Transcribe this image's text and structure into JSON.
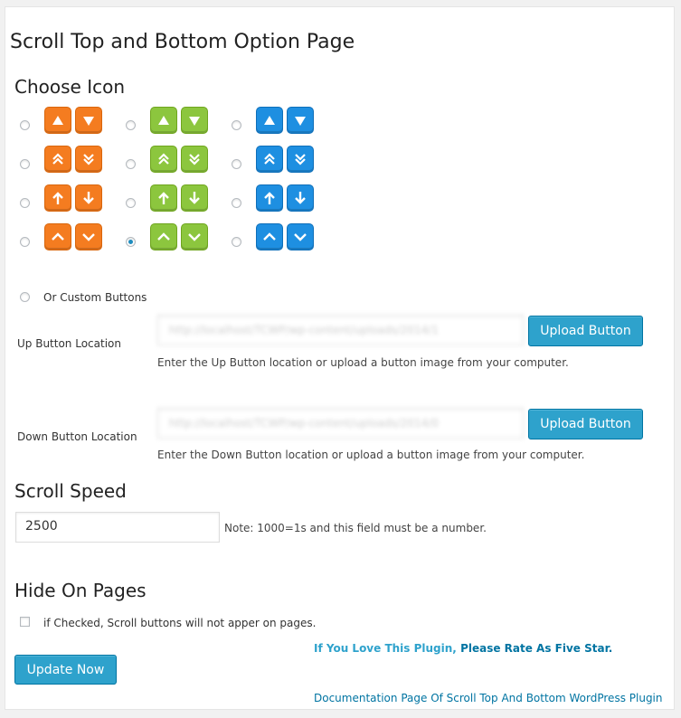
{
  "page_title": "Scroll Top and Bottom Option Page",
  "choose_icon": {
    "heading": "Choose Icon",
    "selected": "green-chevron",
    "colors": {
      "orange": "#f47c20",
      "green": "#8cc63e",
      "blue": "#1e8fe1"
    },
    "styles": [
      "triangle",
      "double-chevron",
      "arrow",
      "chevron"
    ]
  },
  "custom_buttons": {
    "label": "Or Custom Buttons",
    "up": {
      "label": "Up Button Location",
      "value": "http://localhost/TCWP/wp-content/uploads/2014/1",
      "button": "Upload Button",
      "description": "Enter the Up Button location or upload a button image from your computer."
    },
    "down": {
      "label": "Down Button Location",
      "value": "http://localhost/TCWP/wp-content/uploads/2014/0",
      "button": "Upload Button",
      "description": "Enter the Down Button location or upload a button image from your computer."
    }
  },
  "scroll_speed": {
    "heading": "Scroll Speed",
    "value": "2500",
    "note": "Note: 1000=1s and this field must be a number."
  },
  "hide_on_pages": {
    "heading": "Hide On Pages",
    "checkbox_label": "if Checked, Scroll buttons will not apper on pages.",
    "checked": false
  },
  "footer": {
    "update_button": "Update Now",
    "love_text": "If You Love This Plugin,",
    "rate_text": "Please Rate As Five Star.",
    "doc_link": "Documentation Page Of Scroll Top And Bottom WordPress Plugin"
  }
}
